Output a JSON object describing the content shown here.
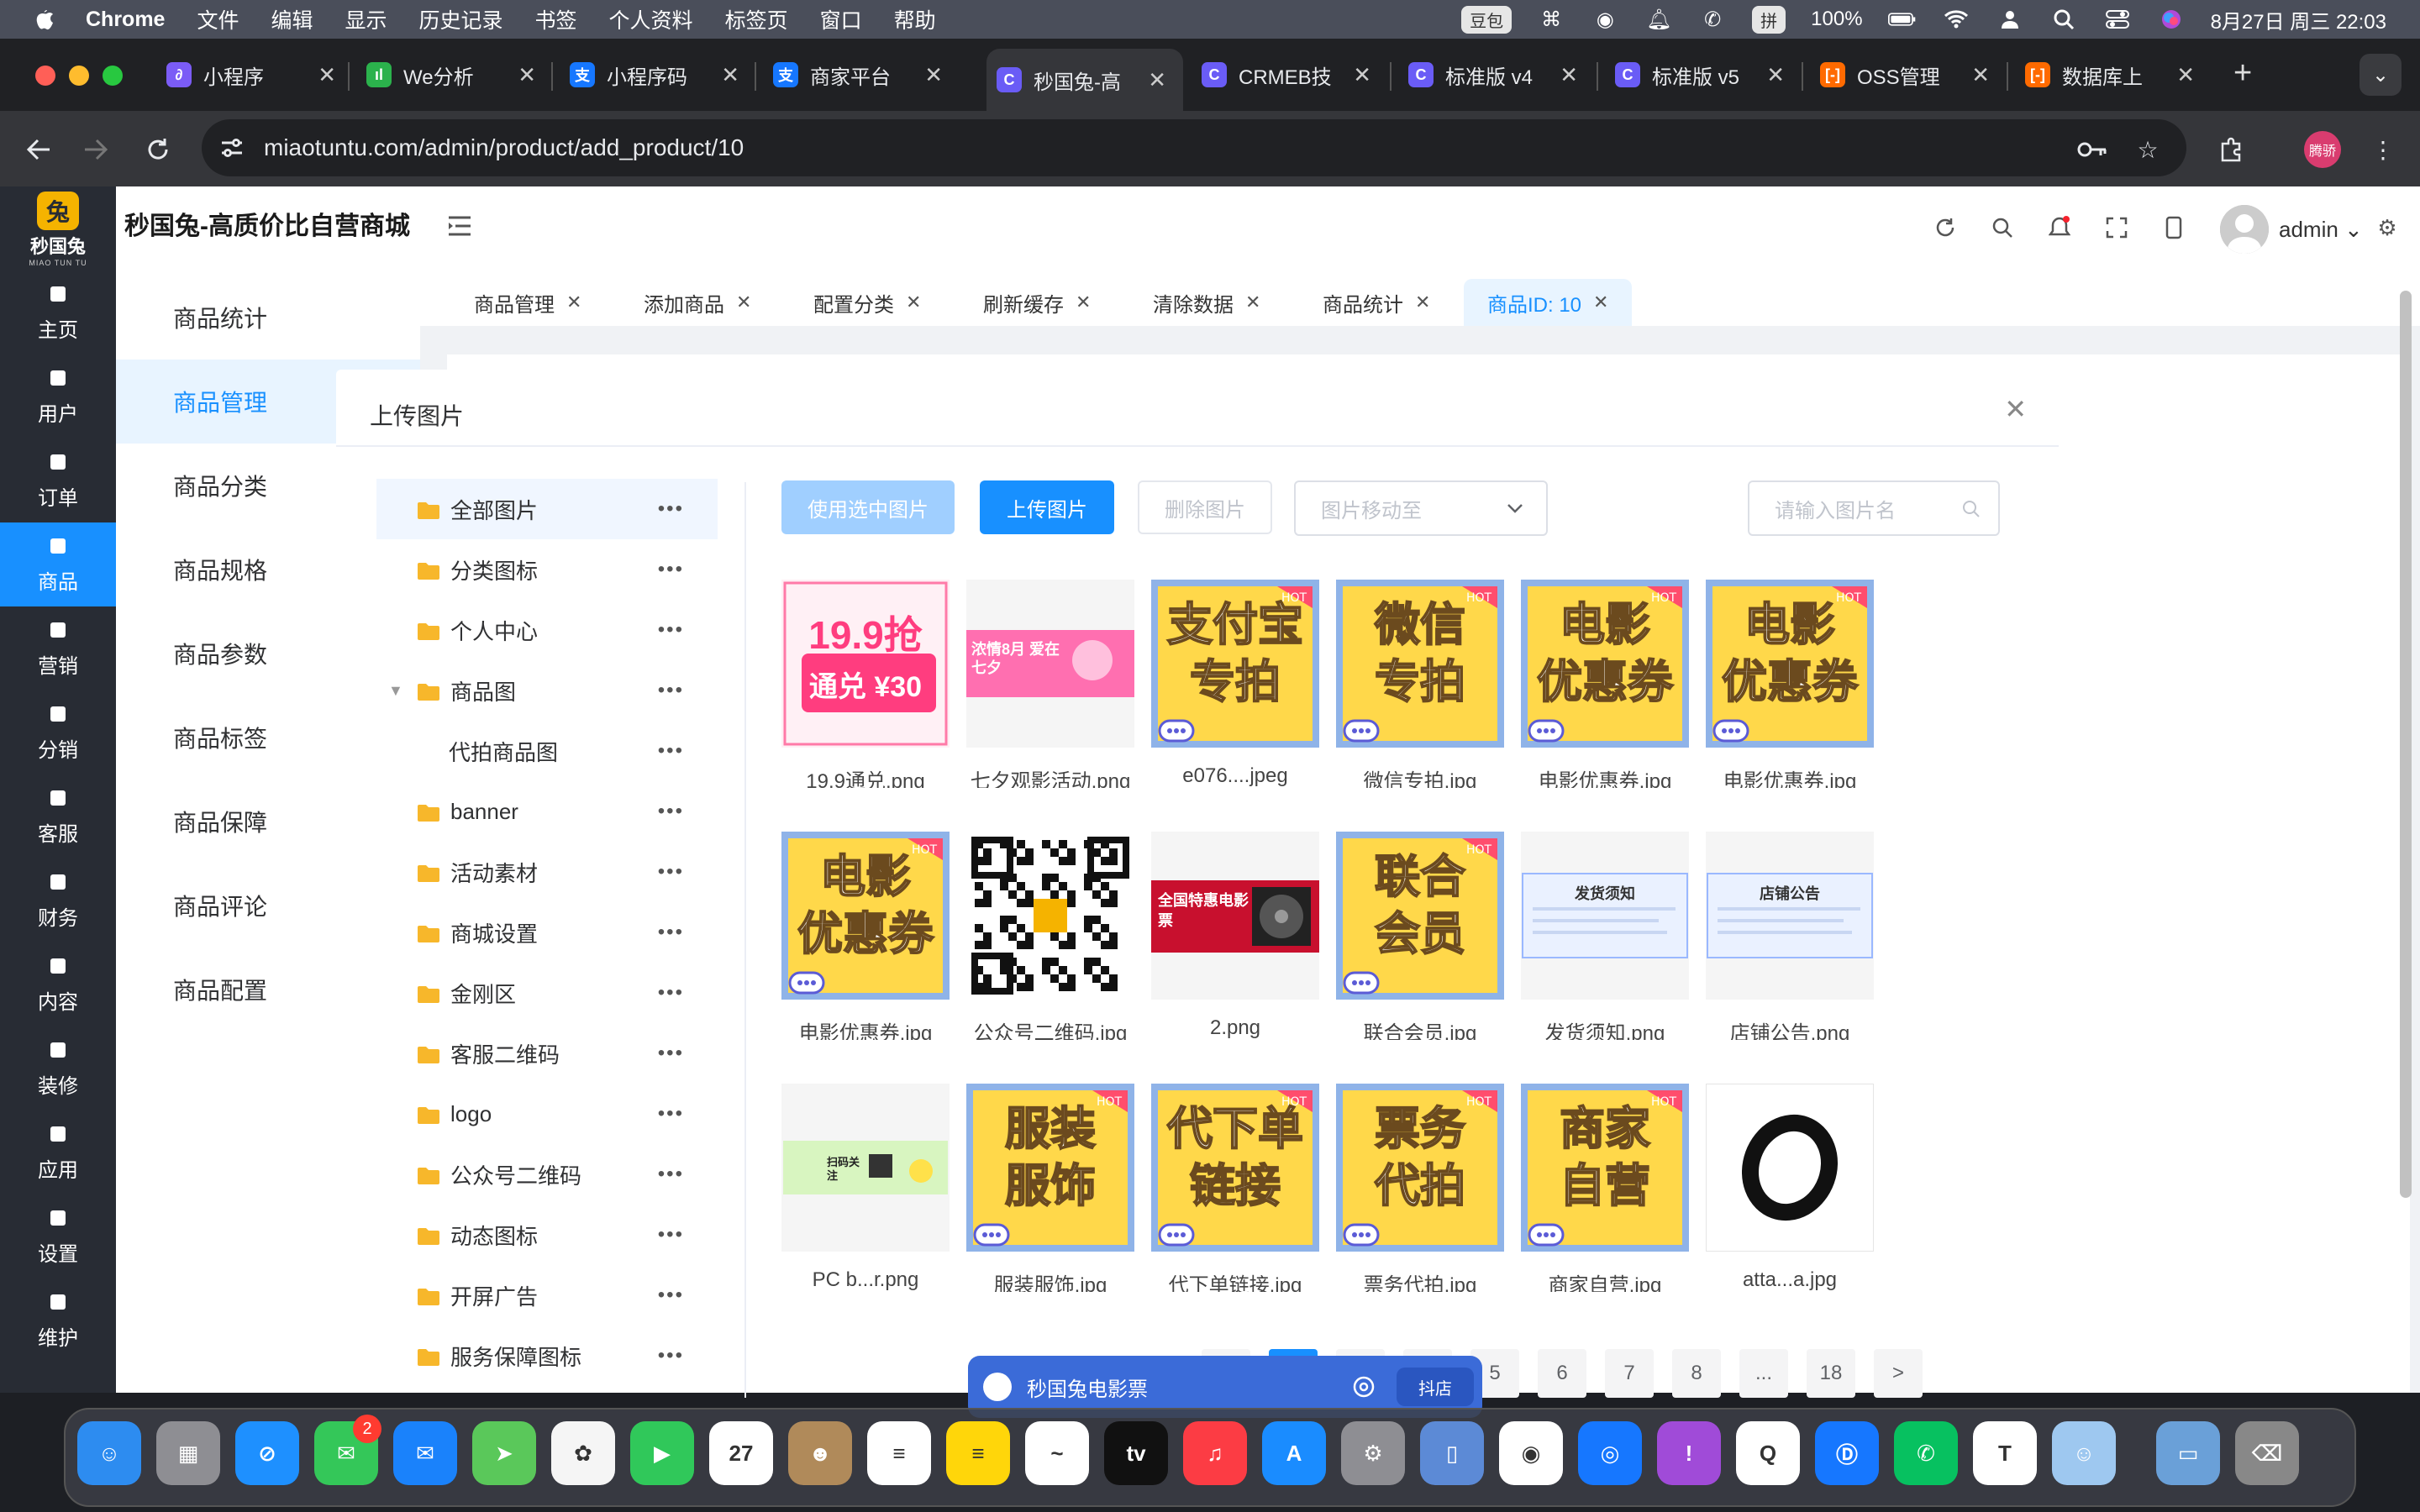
{
  "menubar": {
    "app": "Chrome",
    "items": [
      "文件",
      "编辑",
      "显示",
      "历史记录",
      "书签",
      "个人资料",
      "标签页",
      "窗口",
      "帮助"
    ],
    "doubao": "豆包",
    "pinyin": "拼",
    "battery": "100%",
    "datetime": "8月27日 周三  22:03"
  },
  "browser_tabs": [
    {
      "title": "小程序",
      "fav_color": "#7b5cf6",
      "fav": "∂"
    },
    {
      "title": "We分析",
      "fav_color": "#2bb24c",
      "fav": "ıl"
    },
    {
      "title": "小程序码",
      "fav_color": "#1677ff",
      "fav": "支"
    },
    {
      "title": "商家平台",
      "fav_color": "#1677ff",
      "fav": "支"
    },
    {
      "title": "秒国兔-高",
      "fav_color": "#6a5cf6",
      "fav": "C"
    },
    {
      "title": "CRMEB技",
      "fav_color": "#6a5cf6",
      "fav": "C"
    },
    {
      "title": "标准版 v4",
      "fav_color": "#6a5cf6",
      "fav": "C"
    },
    {
      "title": "标准版 v5",
      "fav_color": "#6a5cf6",
      "fav": "C"
    },
    {
      "title": "OSS管理",
      "fav_color": "#ff6a00",
      "fav": "[-]"
    },
    {
      "title": "数据库上",
      "fav_color": "#ff6a00",
      "fav": "[-]"
    }
  ],
  "address": "miaotuntu.com/admin/product/add_product/10",
  "profile_label": "腾骄",
  "app": {
    "logo_char": "兔",
    "logo_title": "秒国兔",
    "logo_sub": "MIAO TUN TU",
    "brand": "秒国兔-高质价比自营商城",
    "user": "admin"
  },
  "left_nav": [
    "主页",
    "用户",
    "订单",
    "商品",
    "营销",
    "分销",
    "客服",
    "财务",
    "内容",
    "装修",
    "应用",
    "设置",
    "维护"
  ],
  "submenu": [
    "商品统计",
    "商品管理",
    "商品分类",
    "商品规格",
    "商品参数",
    "商品标签",
    "商品保障",
    "商品评论",
    "商品配置"
  ],
  "page_tabs": [
    "商品管理",
    "添加商品",
    "配置分类",
    "刷新缓存",
    "清除数据",
    "商品统计",
    "商品ID: 10"
  ],
  "modal": {
    "title": "上传图片",
    "folders": [
      {
        "name": "全部图片",
        "child": false,
        "caret": false
      },
      {
        "name": "分类图标",
        "child": false,
        "caret": false
      },
      {
        "name": "个人中心",
        "child": false,
        "caret": false
      },
      {
        "name": "商品图",
        "child": false,
        "caret": true
      },
      {
        "name": "代拍商品图",
        "child": true,
        "caret": false
      },
      {
        "name": "banner",
        "child": false,
        "caret": false
      },
      {
        "name": "活动素材",
        "child": false,
        "caret": false
      },
      {
        "name": "商城设置",
        "child": false,
        "caret": false
      },
      {
        "name": "金刚区",
        "child": false,
        "caret": false
      },
      {
        "name": "客服二维码",
        "child": false,
        "caret": false
      },
      {
        "name": "logo",
        "child": false,
        "caret": false
      },
      {
        "name": "公众号二维码",
        "child": false,
        "caret": false
      },
      {
        "name": "动态图标",
        "child": false,
        "caret": false
      },
      {
        "name": "开屏广告",
        "child": false,
        "caret": false
      },
      {
        "name": "服务保障图标",
        "child": false,
        "caret": false
      }
    ],
    "btn_use": "使用选中图片",
    "btn_upload": "上传图片",
    "btn_delete": "删除图片",
    "move_placeholder": "图片移动至",
    "search_placeholder": "请输入图片名",
    "images": [
      {
        "caption": "19.9通兑.png",
        "kind": "promo",
        "t1": "19.9抢",
        "t2": "通兑 ¥30"
      },
      {
        "caption": "七夕观影活动.png",
        "kind": "banner-pink",
        "t1": "浓情8月 爱在七夕"
      },
      {
        "caption": "e076....jpeg",
        "kind": "hot",
        "t1": "支付宝",
        "t2": "专拍"
      },
      {
        "caption": "微信专拍.jpg",
        "kind": "hot",
        "t1": "微信",
        "t2": "专拍"
      },
      {
        "caption": "电影优惠券.jpg",
        "kind": "hot",
        "t1": "电影",
        "t2": "优惠券"
      },
      {
        "caption": "电影优惠券.jpg",
        "kind": "hot",
        "t1": "电影",
        "t2": "优惠券"
      },
      {
        "caption": "电影优惠券.jpg",
        "kind": "hot",
        "t1": "电影",
        "t2": "优惠券"
      },
      {
        "caption": "公众号二维码.jpg",
        "kind": "qr",
        "t1": ""
      },
      {
        "caption": "2.png",
        "kind": "movie",
        "t1": "全国特惠电影票"
      },
      {
        "caption": "联合会员.jpg",
        "kind": "hot",
        "t1": "联合",
        "t2": "会员"
      },
      {
        "caption": "发货须知.png",
        "kind": "notice",
        "t1": "发货须知"
      },
      {
        "caption": "店铺公告.png",
        "kind": "notice",
        "t1": "店铺公告"
      },
      {
        "caption": "PC b...r.png",
        "kind": "pcbanner",
        "t1": "扫码关注"
      },
      {
        "caption": "服装服饰.jpg",
        "kind": "hot",
        "t1": "服装",
        "t2": "服饰"
      },
      {
        "caption": "代下单链接.jpg",
        "kind": "hot",
        "t1": "代下单",
        "t2": "链接"
      },
      {
        "caption": "票务代拍.jpg",
        "kind": "hot",
        "t1": "票务",
        "t2": "代拍"
      },
      {
        "caption": "商家自营.jpg",
        "kind": "hot",
        "t1": "商家",
        "t2": "自营"
      },
      {
        "caption": "atta...a.jpg",
        "kind": "ring",
        "t1": ""
      }
    ],
    "pager": [
      "",
      "",
      "",
      "",
      "5",
      "6",
      "7",
      "8",
      "...",
      "18",
      ">"
    ]
  },
  "floatbar": {
    "title": "秒国兔电影票",
    "dy": "抖店"
  },
  "dock": [
    {
      "name": "finder",
      "color": "#2d8cf0",
      "g": "☺"
    },
    {
      "name": "launchpad",
      "color": "#8e8e93",
      "g": "▦"
    },
    {
      "name": "safari",
      "color": "#1e90ff",
      "g": "⊘"
    },
    {
      "name": "messages",
      "color": "#34c759",
      "g": "✉"
    },
    {
      "name": "mail",
      "color": "#1a82fb",
      "g": "✉"
    },
    {
      "name": "maps",
      "color": "#5ac85a",
      "g": "➤"
    },
    {
      "name": "photos",
      "color": "#f5f5f5",
      "g": "✿"
    },
    {
      "name": "facetime",
      "color": "#30c85a",
      "g": "▶"
    },
    {
      "name": "calendar",
      "color": "#ffffff",
      "g": "27"
    },
    {
      "name": "contacts",
      "color": "#b08a5a",
      "g": "☻"
    },
    {
      "name": "reminders",
      "color": "#ffffff",
      "g": "≡"
    },
    {
      "name": "notes",
      "color": "#ffd60a",
      "g": "≡"
    },
    {
      "name": "freeform",
      "color": "#ffffff",
      "g": "~"
    },
    {
      "name": "tv",
      "color": "#111111",
      "g": "tv"
    },
    {
      "name": "music",
      "color": "#fc3c44",
      "g": "♫"
    },
    {
      "name": "appstore",
      "color": "#1a8cff",
      "g": "A"
    },
    {
      "name": "settings",
      "color": "#8e8e93",
      "g": "⚙"
    },
    {
      "name": "iphone-mirroring",
      "color": "#5c8ad6",
      "g": "▯"
    },
    {
      "name": "chrome",
      "color": "#ffffff",
      "g": "◉"
    },
    {
      "name": "browser",
      "color": "#1677ff",
      "g": "◎"
    },
    {
      "name": "feedback",
      "color": "#a04bd8",
      "g": "!"
    },
    {
      "name": "qq",
      "color": "#ffffff",
      "g": "Q"
    },
    {
      "name": "douyin-shop",
      "color": "#1677ff",
      "g": "Ⓓ"
    },
    {
      "name": "wechat",
      "color": "#07c160",
      "g": "✆"
    },
    {
      "name": "tencent-meeting",
      "color": "#ffffff",
      "g": "T"
    },
    {
      "name": "avatar-app",
      "color": "#9ec8f0",
      "g": "☺"
    },
    {
      "name": "preview",
      "color": "#6aa0d8",
      "g": "▭"
    },
    {
      "name": "trash",
      "color": "#888888",
      "g": "⌫"
    }
  ],
  "dock_badge": "2"
}
